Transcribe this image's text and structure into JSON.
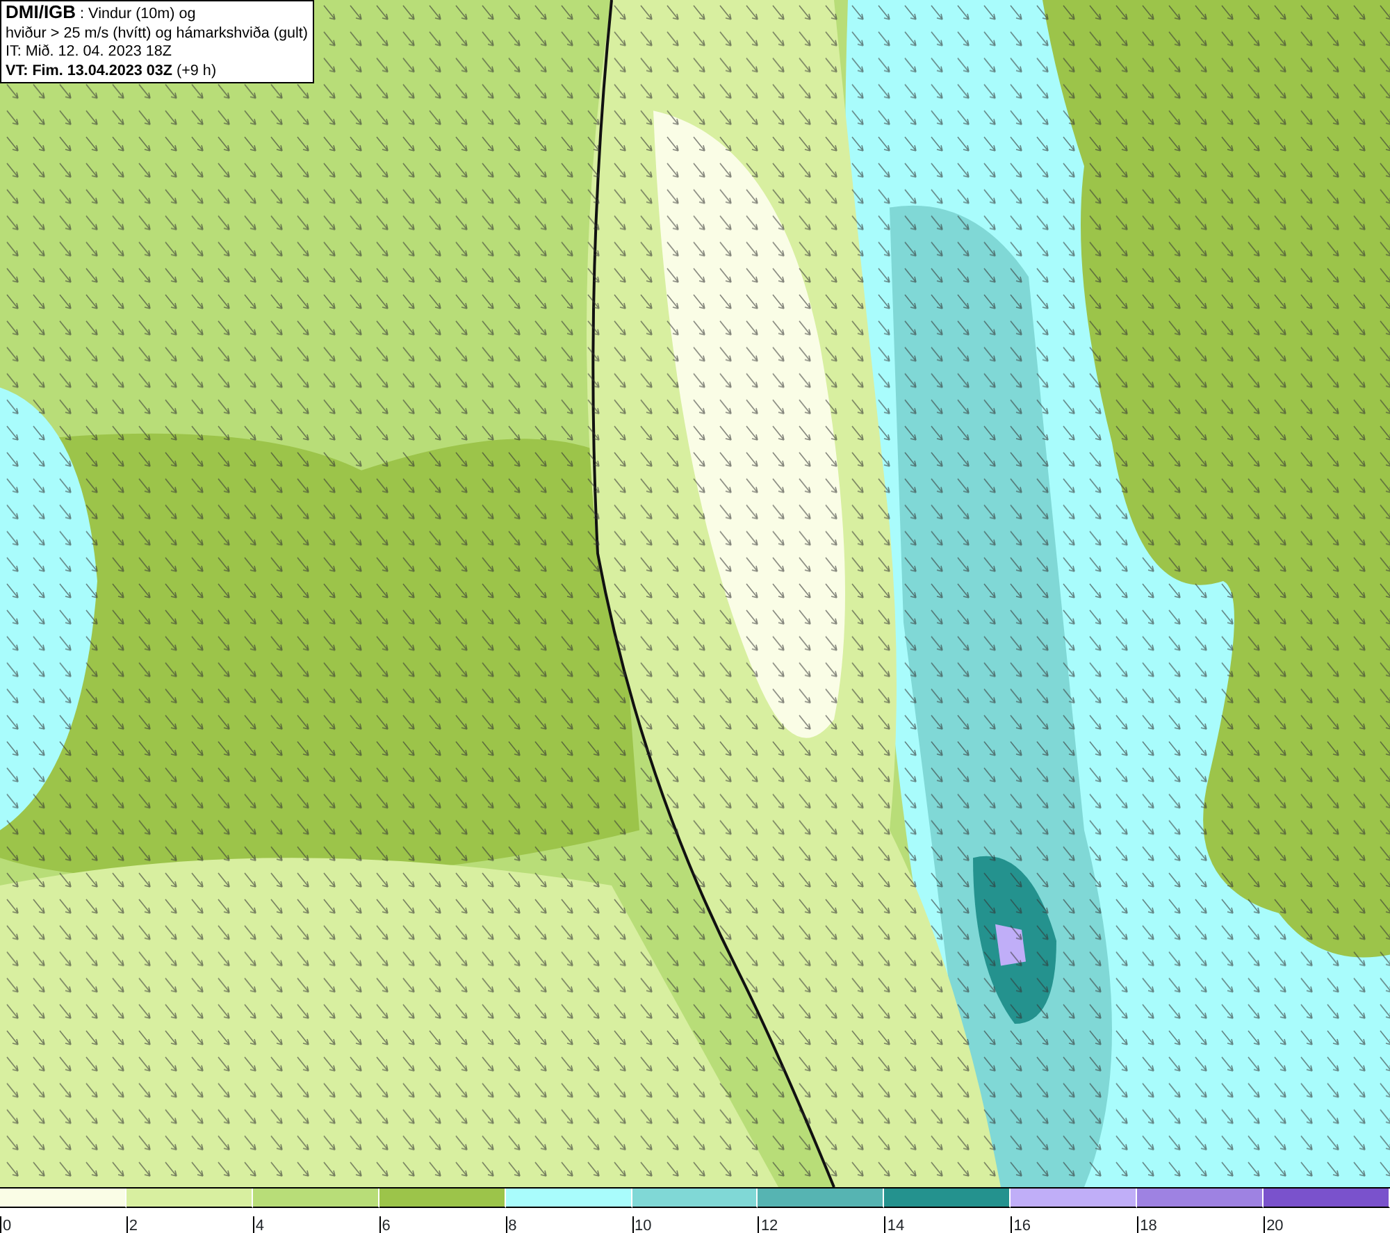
{
  "header": {
    "lines": [
      "**DMI/IGB** : Vindur (10m) og",
      "hviður > 25 m/s (hvítt) og hámarkshviða (gult)",
      "IT: Mið. 12. 04. 2023 18Z",
      "**VT: Fim. 13.04.2023 03Z** (+9 h)"
    ]
  },
  "legend": {
    "bins": [
      {
        "color": "#fafde6",
        "label": "0"
      },
      {
        "color": "#d8efa0",
        "label": "2"
      },
      {
        "color": "#b8dd78",
        "label": "4"
      },
      {
        "color": "#9cc44a",
        "label": "6"
      },
      {
        "color": "#a9fcfc",
        "label": "8"
      },
      {
        "color": "#80d8d6",
        "label": "10"
      },
      {
        "color": "#56b4b2",
        "label": "12"
      },
      {
        "color": "#24928e",
        "label": "14"
      },
      {
        "color": "#c0aef8",
        "label": "16"
      },
      {
        "color": "#9e82e2",
        "label": "18"
      },
      {
        "color": "#7a52cc",
        "label": "20"
      }
    ]
  }
}
